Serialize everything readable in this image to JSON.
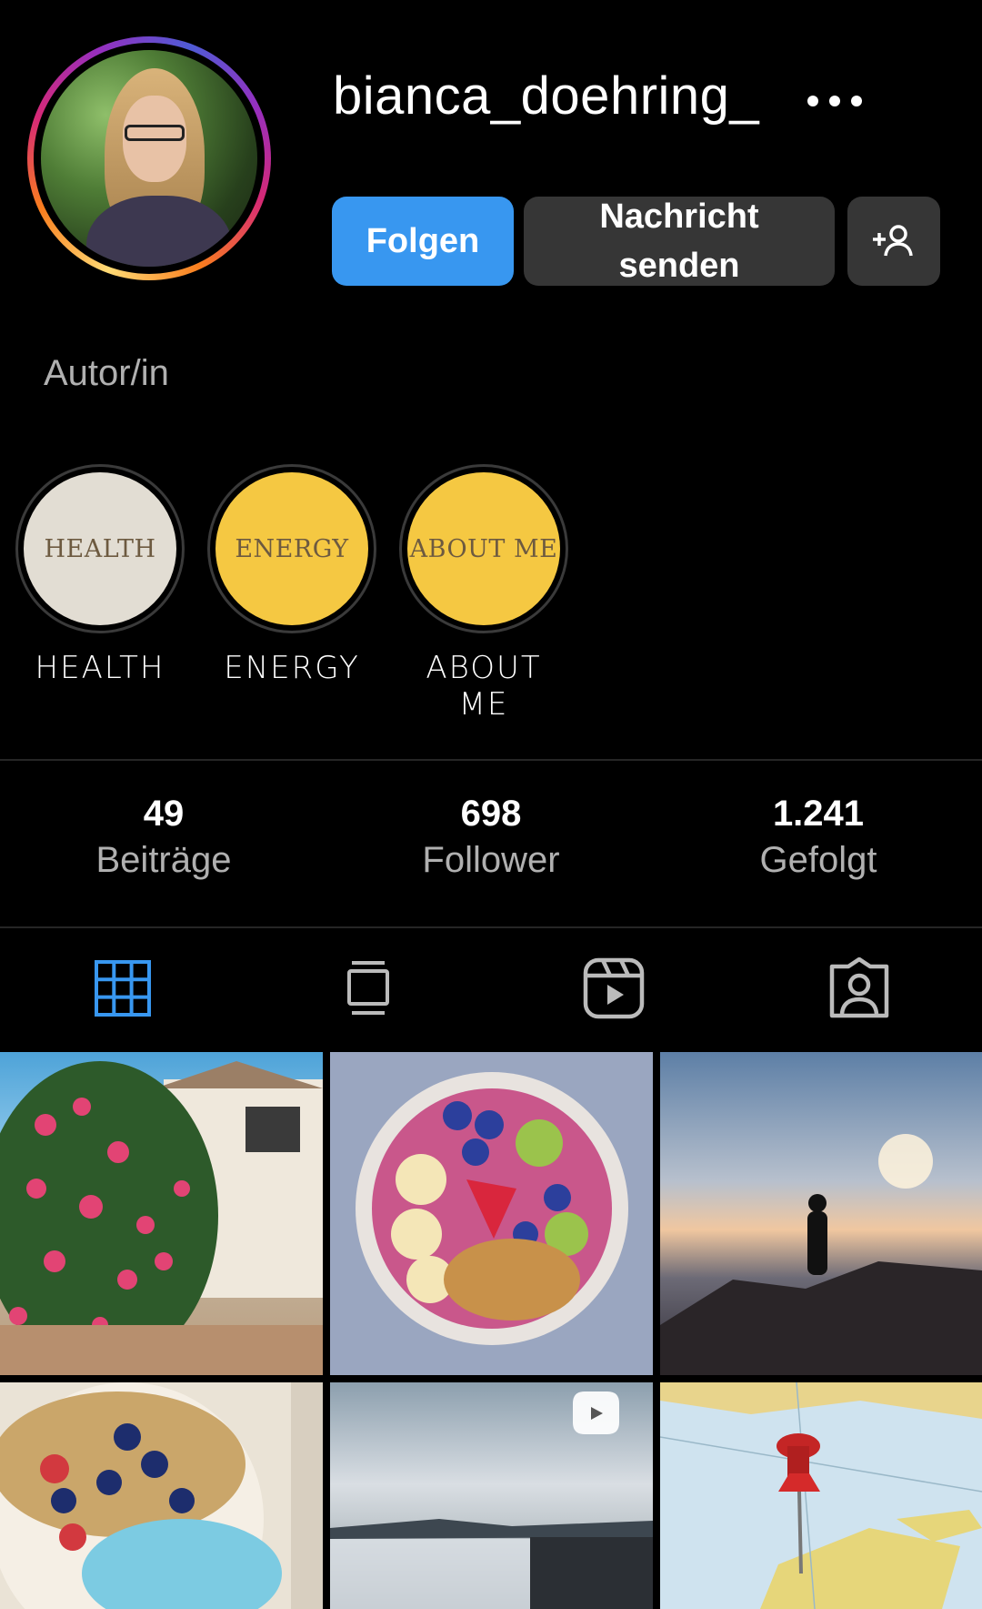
{
  "profile": {
    "username": "bianca_doehring_",
    "category": "Autor/in"
  },
  "actions": {
    "follow_label": "Folgen",
    "message_label_line1": "Nachricht",
    "message_label_line2": "senden"
  },
  "highlights": [
    {
      "cover_text": "HEALTH",
      "label": "HEALTH",
      "cover_color": "#e2ddd3"
    },
    {
      "cover_text": "ENERGY",
      "label": "ENERGY",
      "cover_color": "#f5c842"
    },
    {
      "cover_text": "ABOUT ME",
      "label": "ABOUT ME",
      "cover_color": "#f5c842"
    }
  ],
  "stats": [
    {
      "value": "49",
      "label": "Beiträge"
    },
    {
      "value": "698",
      "label": "Follower"
    },
    {
      "value": "1.241",
      "label": "Gefolgt"
    }
  ],
  "tabs": [
    "grid-icon",
    "guides-icon",
    "reels-icon",
    "tagged-icon"
  ],
  "colors": {
    "accent": "#3897f0",
    "button_dark": "#363636",
    "active_tab": "#3897f0",
    "highlight_yellow": "#f5c842"
  }
}
